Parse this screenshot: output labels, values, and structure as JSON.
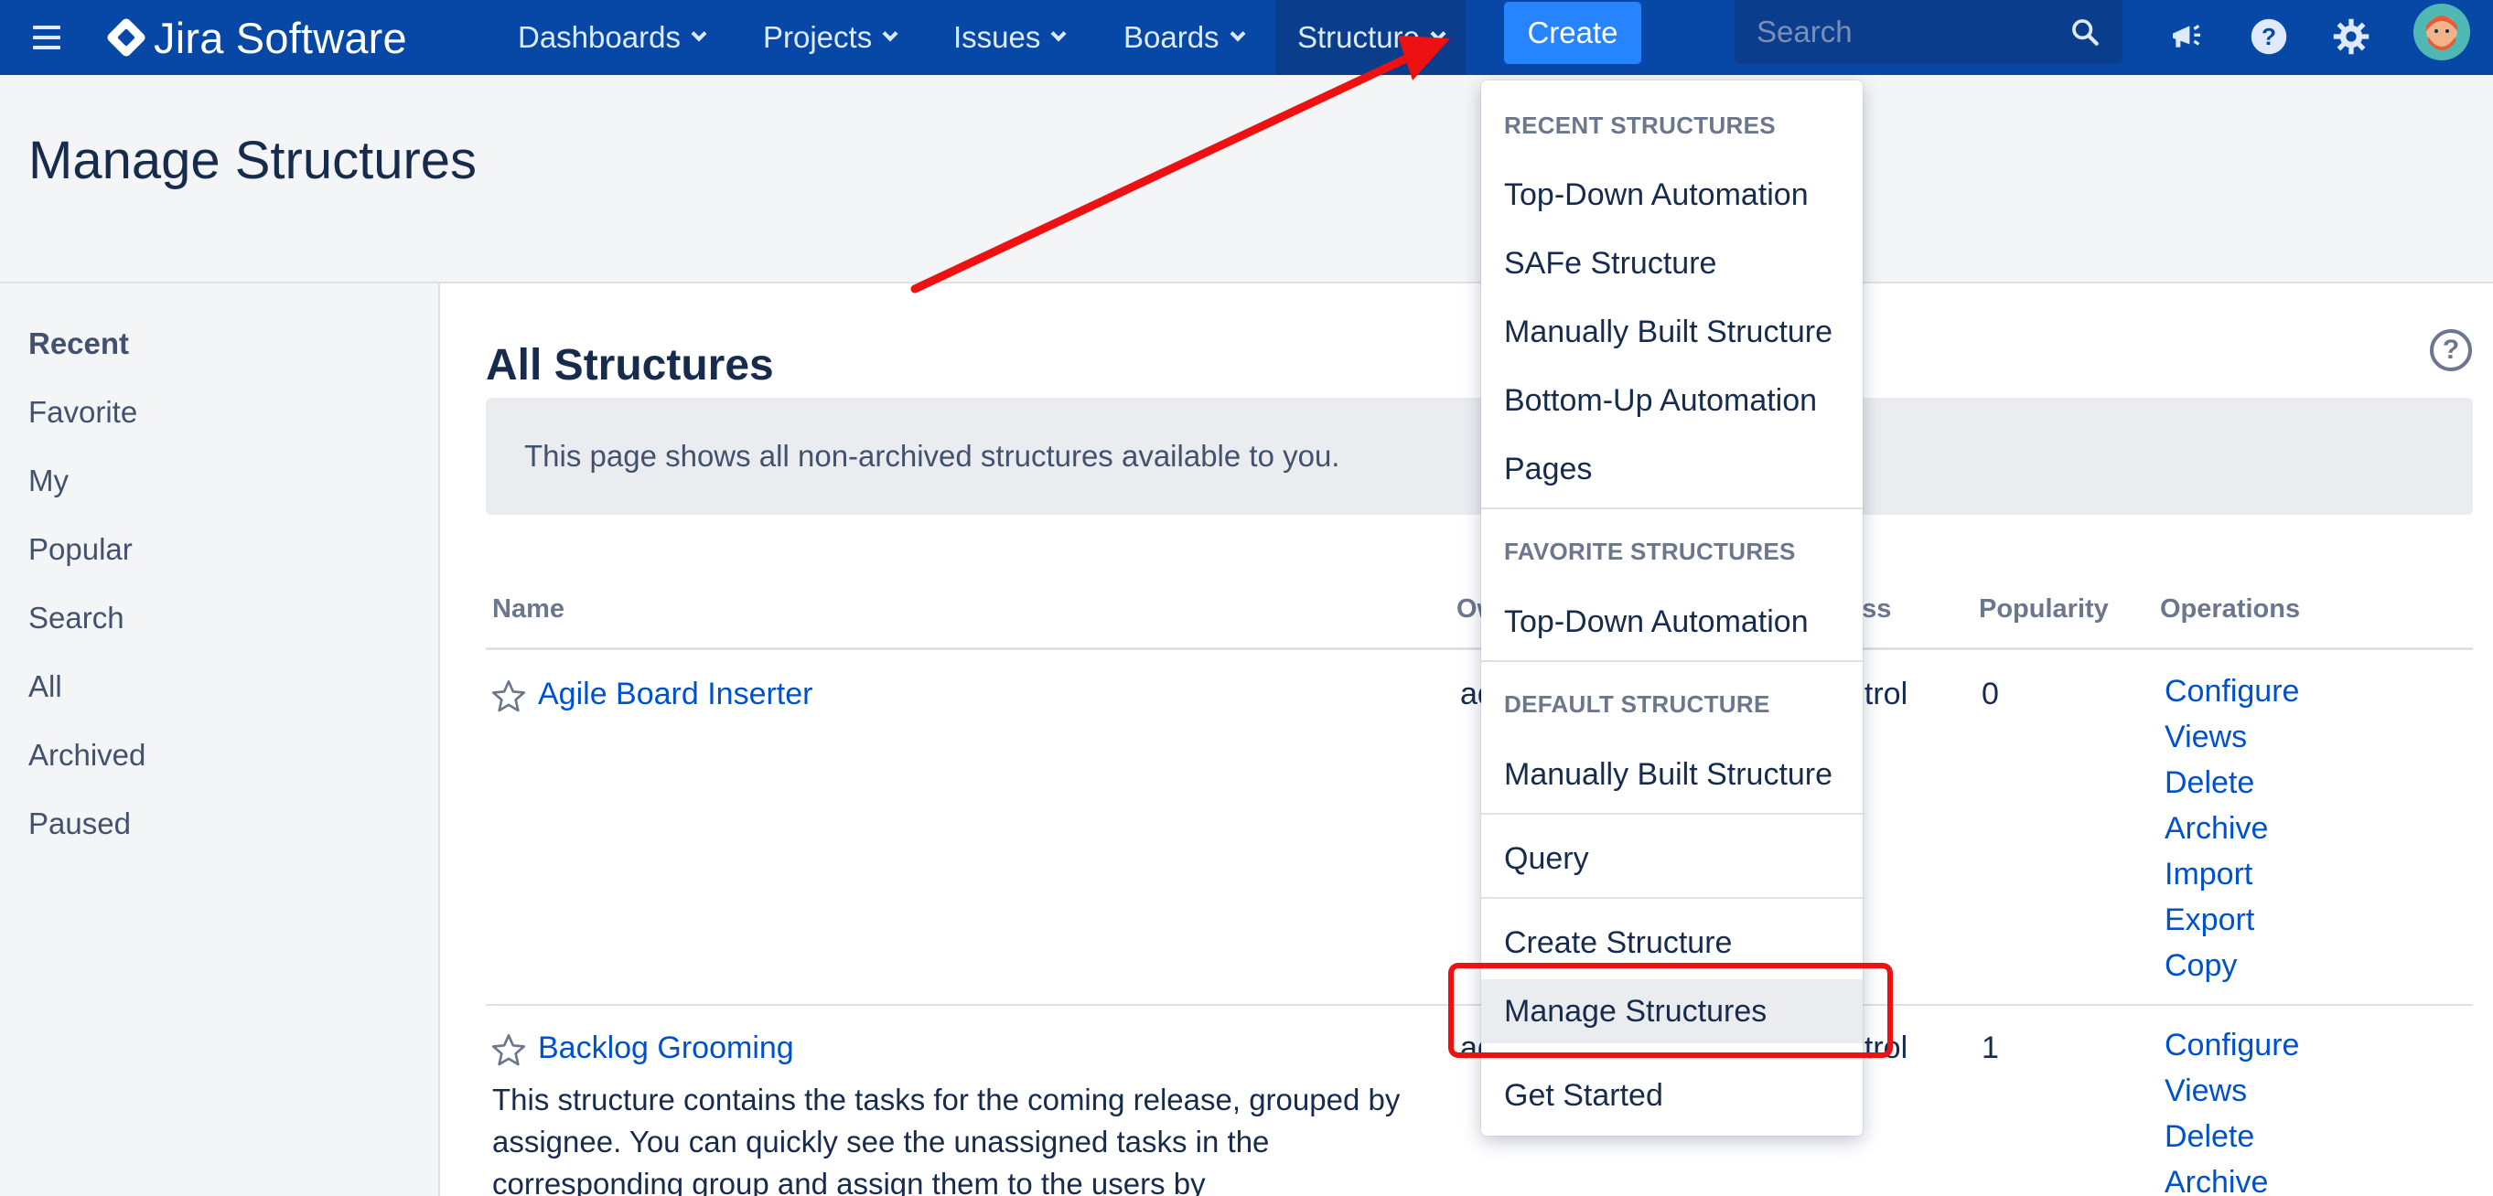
{
  "topnav": {
    "brand": "Jira Software",
    "items": [
      {
        "label": "Dashboards"
      },
      {
        "label": "Projects"
      },
      {
        "label": "Issues"
      },
      {
        "label": "Boards"
      },
      {
        "label": "Structure"
      }
    ],
    "create_label": "Create",
    "search_placeholder": "Search",
    "icons": [
      "menu-icon",
      "jira-logo-icon",
      "search-icon",
      "megaphone-icon",
      "help-icon",
      "settings-gear-icon",
      "user-avatar"
    ]
  },
  "page": {
    "title": "Manage Structures"
  },
  "sidebar": {
    "items": [
      {
        "label": "Recent",
        "active": true
      },
      {
        "label": "Favorite"
      },
      {
        "label": "My"
      },
      {
        "label": "Popular"
      },
      {
        "label": "Search"
      },
      {
        "label": "All"
      },
      {
        "label": "Archived"
      },
      {
        "label": "Paused"
      }
    ]
  },
  "main": {
    "title": "All Structures",
    "info": "This page shows all non-archived structures available to you.",
    "columns": {
      "name": "Name",
      "owner": "Ow",
      "access": "ess",
      "popularity": "Popularity",
      "operations": "Operations"
    },
    "rows": [
      {
        "name": "Agile Board Inserter",
        "owner": "ad",
        "access": "ntrol",
        "popularity": "0",
        "description": "",
        "operations": [
          "Configure",
          "Views",
          "Delete",
          "Archive",
          "Import",
          "Export",
          "Copy"
        ]
      },
      {
        "name": "Backlog Grooming",
        "owner": "ad",
        "access": "ntrol",
        "popularity": "1",
        "description": "This structure contains the tasks for the coming release, grouped by assignee. You can quickly see the unassigned tasks in the corresponding group and assign them to the users by",
        "operations": [
          "Configure",
          "Views",
          "Delete",
          "Archive"
        ]
      }
    ]
  },
  "dropdown": {
    "recent_heading": "RECENT STRUCTURES",
    "recent": [
      "Top-Down Automation",
      "SAFe Structure",
      "Manually Built Structure",
      "Bottom-Up Automation",
      "Pages"
    ],
    "favorite_heading": "FAVORITE STRUCTURES",
    "favorite": [
      "Top-Down Automation"
    ],
    "default_heading": "DEFAULT STRUCTURE",
    "default": [
      "Manually Built Structure"
    ],
    "query": "Query",
    "create": "Create Structure",
    "manage": "Manage Structures",
    "get_started": "Get Started"
  },
  "colors": {
    "nav_bg": "#0747a6",
    "create_btn": "#2684ff",
    "link": "#0052cc",
    "annotation_red": "#ee1111"
  }
}
